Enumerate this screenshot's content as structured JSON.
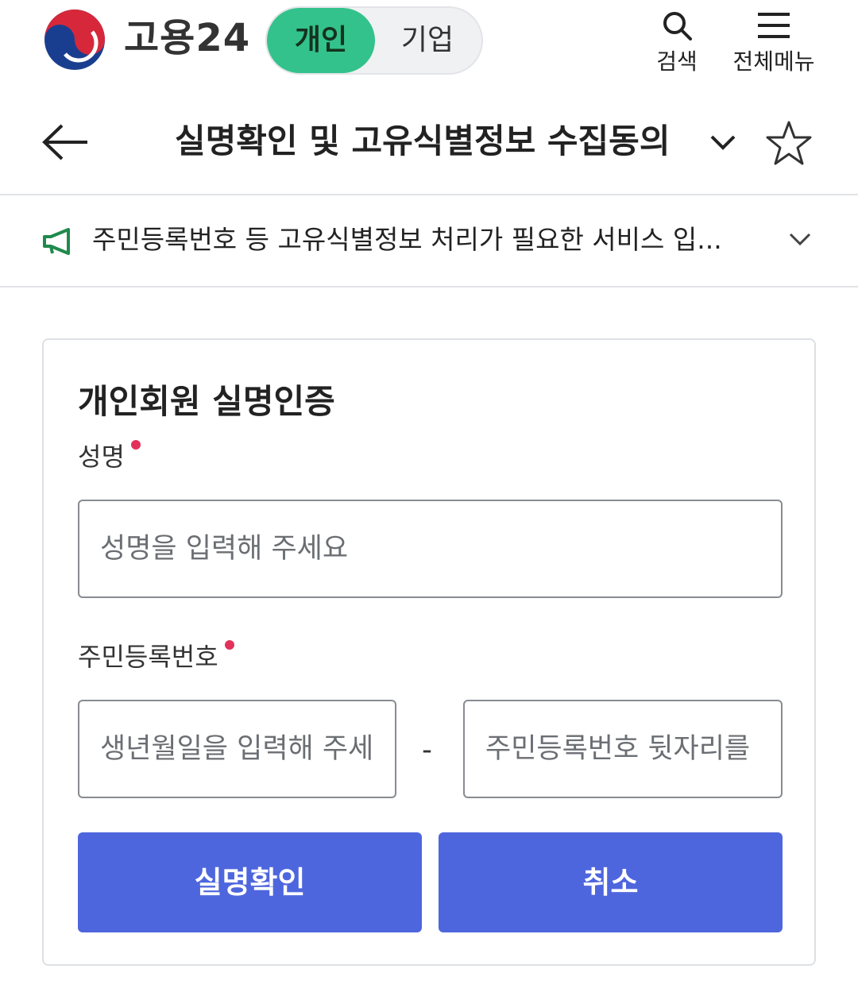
{
  "header": {
    "brand": "고용24",
    "toggle": {
      "active": "개인",
      "inactive": "기업"
    },
    "search_label": "검색",
    "menu_label": "전체메뉴"
  },
  "titlebar": {
    "title": "실명확인 및 고유식별정보 수집동의"
  },
  "notice": {
    "text": "주민등록번호 등 고유식별정보 처리가 필요한 서비스 입..."
  },
  "form": {
    "title": "개인회원 실명인증",
    "name_label": "성명",
    "name_placeholder": "성명을 입력해 주세요",
    "rrn_label": "주민등록번호",
    "rrn_front_placeholder": "생년월일을 입력해 주세요",
    "rrn_separator": "-",
    "rrn_back_placeholder": "주민등록번호 뒷자리를 입력해 주세요",
    "confirm_button": "실명확인",
    "cancel_button": "취소"
  },
  "colors": {
    "toggle_active": "#33c28b",
    "button_primary": "#4e66dd",
    "required_dot": "#e2315b",
    "notice_icon": "#1f8a4c"
  }
}
